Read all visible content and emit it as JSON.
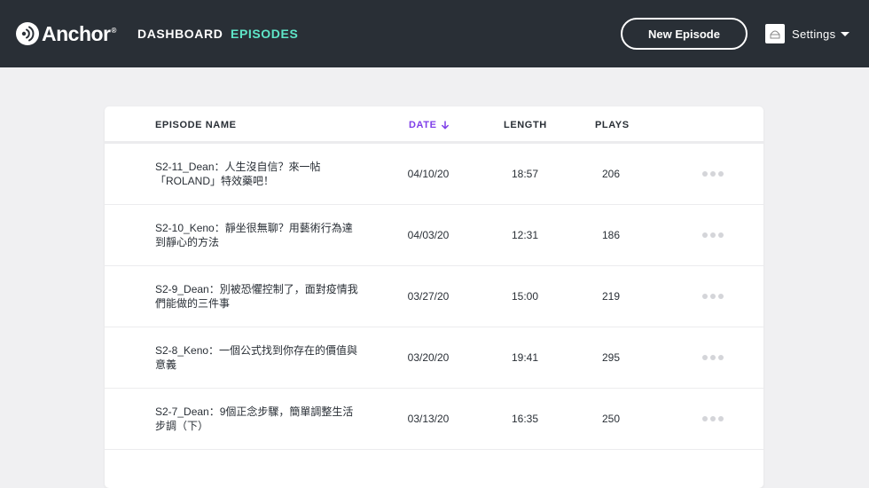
{
  "header": {
    "logo_text": "Anchor",
    "logo_reg": "®",
    "nav": {
      "dashboard": "DASHBOARD",
      "episodes": "EPISODES"
    },
    "new_episode_label": "New Episode",
    "settings_label": "Settings"
  },
  "colors": {
    "topbar": "#292f36",
    "active_nav": "#5fe6c8",
    "sort_accent": "#7f3fe8",
    "page_bg": "#f0f0f2"
  },
  "table": {
    "columns": {
      "name": "EPISODE NAME",
      "date": "DATE",
      "length": "LENGTH",
      "plays": "PLAYS"
    },
    "sort_icon": "arrow-down-icon",
    "rows": [
      {
        "name": "S2-11_Dean：人生沒自信？來一帖「ROLAND」特效藥吧！",
        "date": "04/10/20",
        "length": "18:57",
        "plays": "206"
      },
      {
        "name": "S2-10_Keno：靜坐很無聊？用藝術行為達到靜心的方法",
        "date": "04/03/20",
        "length": "12:31",
        "plays": "186"
      },
      {
        "name": "S2-9_Dean：別被恐懼控制了，面對疫情我們能做的三件事",
        "date": "03/27/20",
        "length": "15:00",
        "plays": "219"
      },
      {
        "name": "S2-8_Keno：一個公式找到你存在的價值與意義",
        "date": "03/20/20",
        "length": "19:41",
        "plays": "295"
      },
      {
        "name": "S2-7_Dean：9個正念步驟，簡單調整生活步調（下）",
        "date": "03/13/20",
        "length": "16:35",
        "plays": "250"
      }
    ]
  }
}
